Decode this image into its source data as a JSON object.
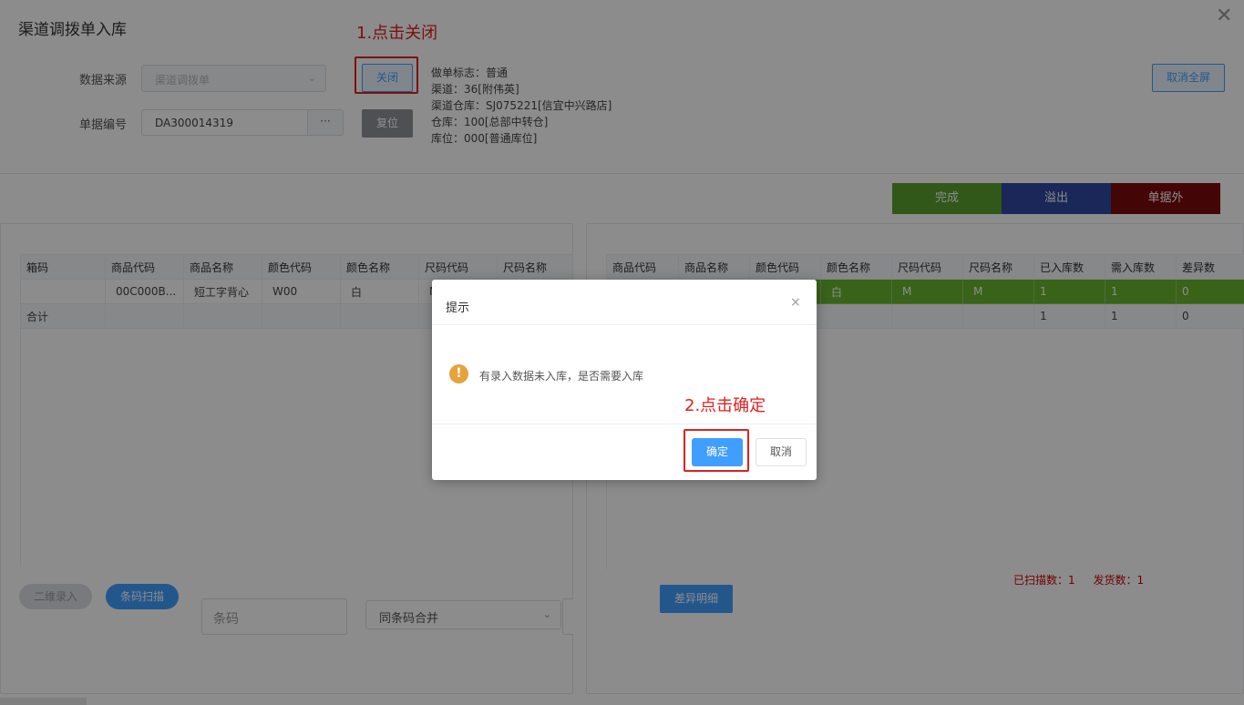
{
  "header": {
    "title": "渠道调拨单入库",
    "close_glyph": "✕"
  },
  "form": {
    "source_label": "数据来源",
    "source_value": "渠道调拨单",
    "doc_no_label": "单据编号",
    "doc_no_value": "DA300014319",
    "more_glyph": "···",
    "close_button": "关闭",
    "reset_button": "复位"
  },
  "annotations": {
    "step1": "1.点击关闭",
    "step2": "2.点击确定"
  },
  "info_lines": [
    "做单标志：普通",
    "渠道：36[附伟英]",
    "渠道仓库：SJ075221[信宜中兴路店]",
    "仓库：100[总部中转仓]",
    "库位：000[普通库位]"
  ],
  "fullscreen_button": "取消全屏",
  "actions": {
    "complete": "完成",
    "overflow": "溢出",
    "outside": "单据外"
  },
  "colors": {
    "complete": "#5a9f2f",
    "overflow": "#2f4aa0",
    "outside": "#7a0a0a",
    "accent": "#409eff",
    "annotation": "#e02020",
    "warning": "#e6a23c"
  },
  "left_table": {
    "columns": [
      "箱码",
      "商品代码",
      "商品名称",
      "颜色代码",
      "颜色名称",
      "尺码代码",
      "尺码名称"
    ],
    "rows": [
      [
        "",
        "00C000B...",
        "短工字背心",
        "W00",
        "白",
        "M",
        ""
      ]
    ],
    "total_label": "合计"
  },
  "right_table": {
    "columns": [
      "商品代码",
      "商品名称",
      "颜色代码",
      "颜色名称",
      "尺码代码",
      "尺码名称",
      "已入库数",
      "需入库数",
      "差异数"
    ],
    "rows": [
      [
        "",
        "",
        "",
        "白",
        "M",
        "M",
        "1",
        "1",
        "0"
      ]
    ],
    "totals": [
      "",
      "",
      "",
      "",
      "",
      "",
      "1",
      "1",
      "0"
    ]
  },
  "scan": {
    "qr_button": "二维录入",
    "barcode_button": "条码扫描",
    "barcode_placeholder": "条码",
    "merge_value": "同条码合并"
  },
  "stats": {
    "scanned_label": "已扫描数：",
    "scanned": "1",
    "shipped_label": "发货数：",
    "shipped": "1"
  },
  "diff_button": "差异明细",
  "dialog": {
    "title": "提示",
    "close_glyph": "×",
    "warning_glyph": "!",
    "message": "有录入数据未入库，是否需要入库",
    "ok": "确定",
    "cancel": "取消"
  }
}
